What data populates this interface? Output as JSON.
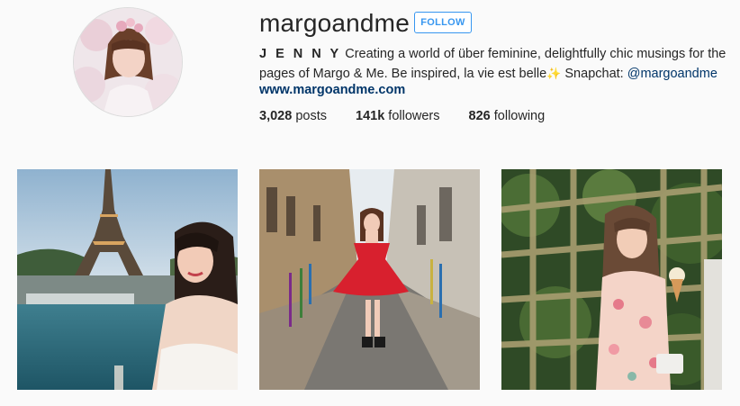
{
  "profile": {
    "username": "margoandme",
    "follow_label": "FOLLOW",
    "bio_name": "J E N N Y",
    "bio_text": "Creating a world of über feminine, delightfully chic musings for the pages of Margo & Me. Be inspired, la vie est belle",
    "bio_sparkle": "✨",
    "bio_snapchat_label": "Snapchat:",
    "bio_snapchat_handle": "@margoandme",
    "website": "www.margoandme.com"
  },
  "stats": {
    "posts_count": "3,028",
    "posts_label": "posts",
    "followers_count": "141k",
    "followers_label": "followers",
    "following_count": "826",
    "following_label": "following"
  },
  "colors": {
    "accent": "#3897f0",
    "link": "#003569",
    "background": "#fafafa"
  }
}
